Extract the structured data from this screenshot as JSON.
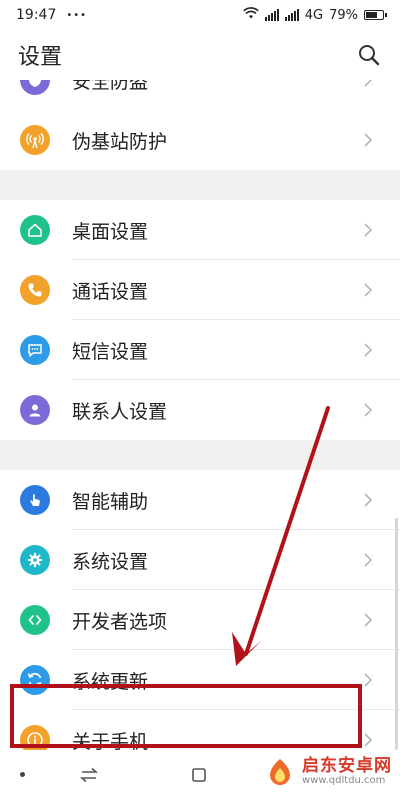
{
  "status_bar": {
    "time": "19:47",
    "dots": "•••",
    "network": "4G",
    "battery": "79%",
    "battery_level": 0.79
  },
  "header": {
    "title": "设置",
    "search_icon": "search-icon"
  },
  "sections": [
    {
      "items": [
        {
          "label": "安全防盗",
          "icon": "shield-icon",
          "color": "#7b6bd8",
          "partial": true
        },
        {
          "label": "伪基站防护",
          "icon": "antenna-icon",
          "color": "#f2a12a"
        }
      ]
    },
    {
      "items": [
        {
          "label": "桌面设置",
          "icon": "home-icon",
          "color": "#1fc28d"
        },
        {
          "label": "通话设置",
          "icon": "phone-icon",
          "color": "#f2a12a"
        },
        {
          "label": "短信设置",
          "icon": "message-icon",
          "color": "#2d9be8"
        },
        {
          "label": "联系人设置",
          "icon": "contact-icon",
          "color": "#7b6bd8"
        }
      ]
    },
    {
      "items": [
        {
          "label": "智能辅助",
          "icon": "touch-icon",
          "color": "#2d7be0"
        },
        {
          "label": "系统设置",
          "icon": "gear-icon",
          "color": "#1fb8c8"
        },
        {
          "label": "开发者选项",
          "icon": "code-icon",
          "color": "#1fc28d"
        },
        {
          "label": "系统更新",
          "icon": "refresh-icon",
          "color": "#2d9be8"
        },
        {
          "label": "关于手机",
          "icon": "info-icon",
          "color": "#f2a12a"
        }
      ]
    }
  ],
  "annotation": {
    "highlight_color": "#b11118"
  },
  "nav": {
    "back_icon": "back-icon",
    "switch_icon": "switch-icon",
    "recent_icon": "square-icon"
  },
  "watermark": {
    "title": "启东安卓网",
    "url": "www.qdltdu.com"
  }
}
